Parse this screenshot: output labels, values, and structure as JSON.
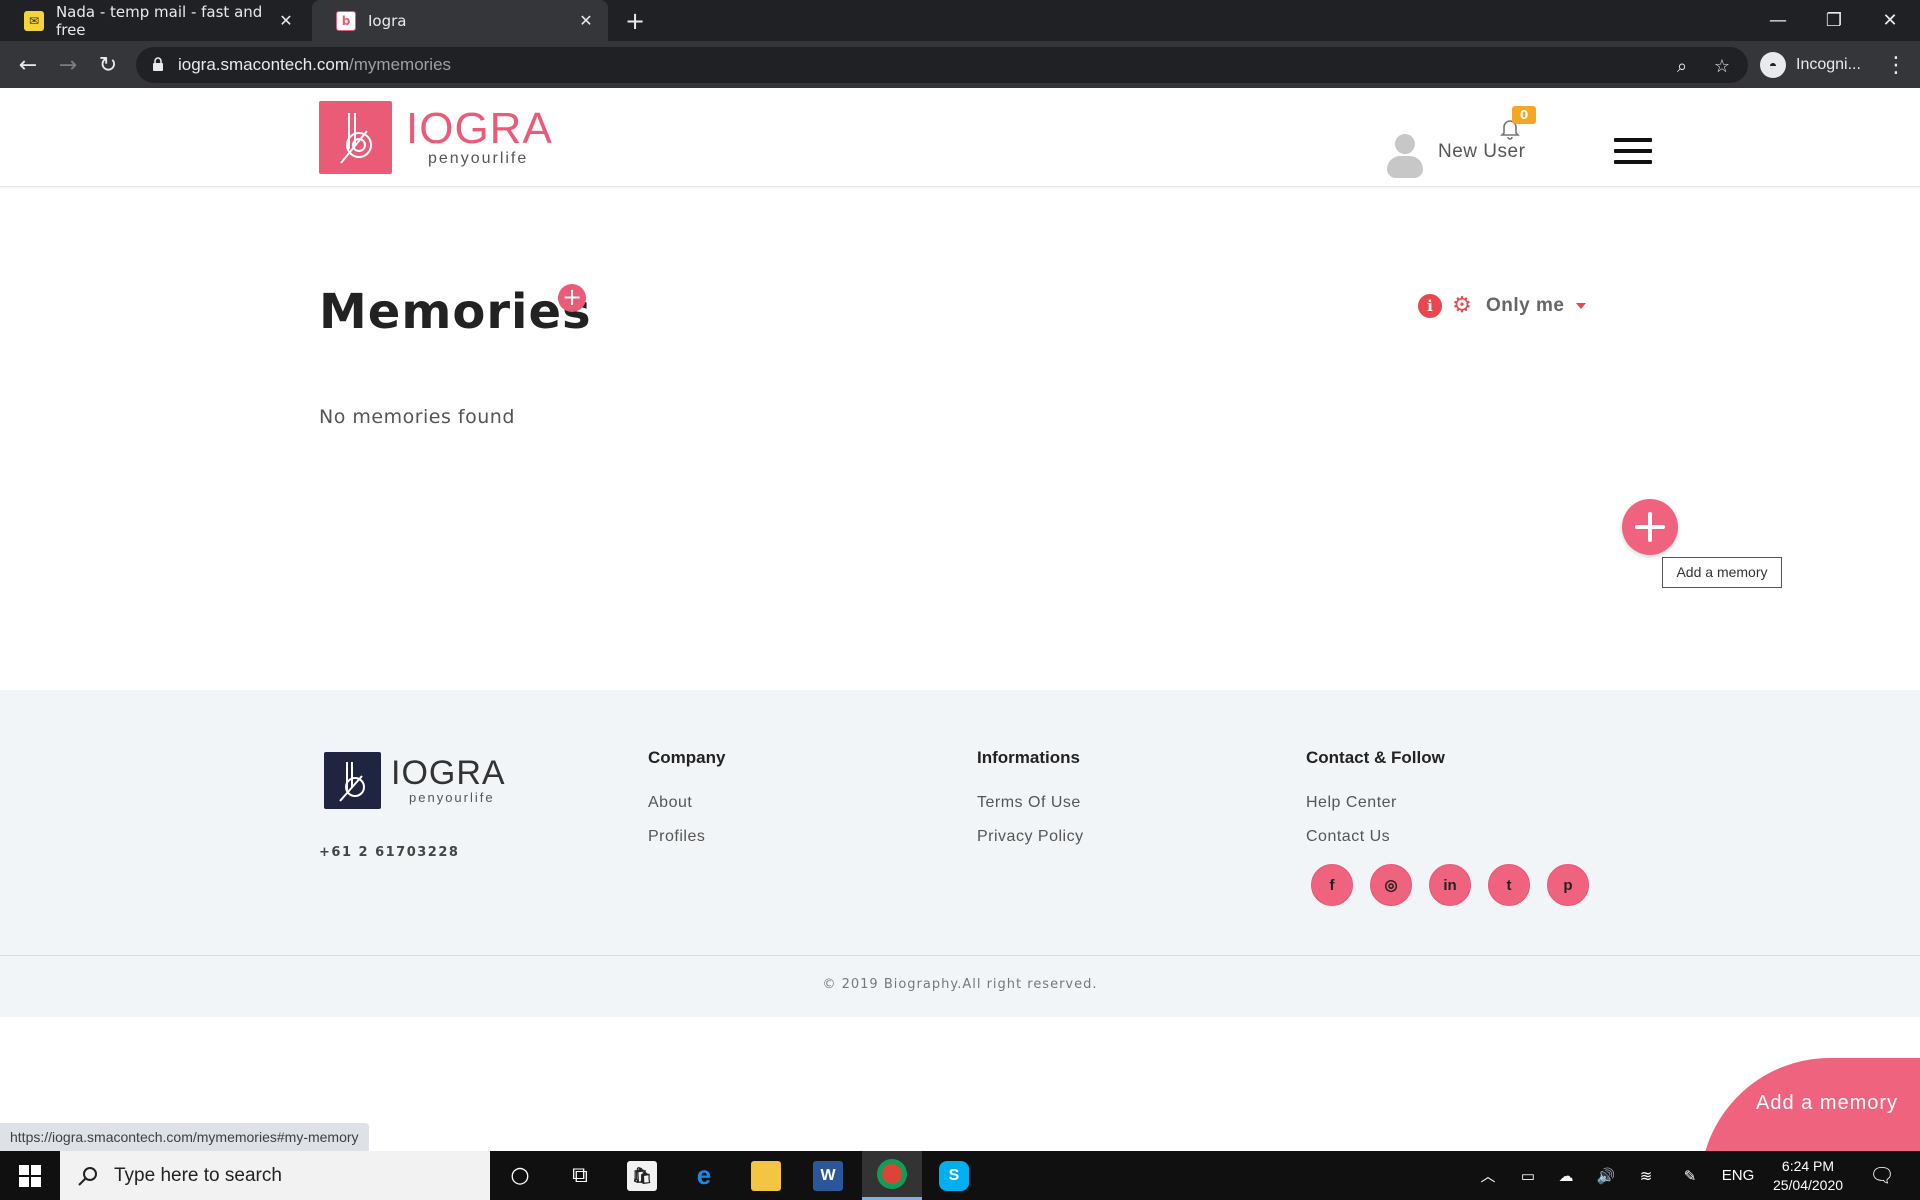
{
  "browser": {
    "tabs": [
      {
        "title": "Nada - temp mail - fast and free",
        "favicon": "nada-icon"
      },
      {
        "title": "Iogra",
        "favicon": "iogra-icon"
      }
    ],
    "url_host": "iogra.smacontech.com",
    "url_path": "/mymemories",
    "profile_label": "Incogni...",
    "status_url": "https://iogra.smacontech.com/mymemories#my-memory"
  },
  "header": {
    "logo_title": "IOGRA",
    "logo_tagline": "penyourlife",
    "username": "New User",
    "notifications_count": "0"
  },
  "main": {
    "title": "Memories",
    "visibility": "Only me",
    "empty_message": "No memories found",
    "fab_tooltip": "Add a memory"
  },
  "footer": {
    "logo_title": "IOGRA",
    "logo_tagline": "penyourlife",
    "phone": "+61 2 61703228",
    "columns": [
      {
        "title": "Company",
        "links": [
          "About",
          "Profiles"
        ]
      },
      {
        "title": "Informations",
        "links": [
          "Terms Of Use",
          "Privacy Policy"
        ]
      },
      {
        "title": "Contact & Follow",
        "links": [
          "Help Center",
          "Contact Us"
        ]
      }
    ],
    "socials": [
      "f",
      "◎",
      "in",
      "t",
      "p"
    ],
    "copyright": "© 2019 Biography.All right reserved."
  },
  "float_button": {
    "label": "Add a memory"
  },
  "taskbar": {
    "search_placeholder": "Type here to search",
    "language": "ENG",
    "time": "6:24 PM",
    "date": "25/04/2020"
  },
  "colors": {
    "brand": "#ea5b77",
    "accent_fab": "#f0637f",
    "badge": "#f5a623"
  }
}
